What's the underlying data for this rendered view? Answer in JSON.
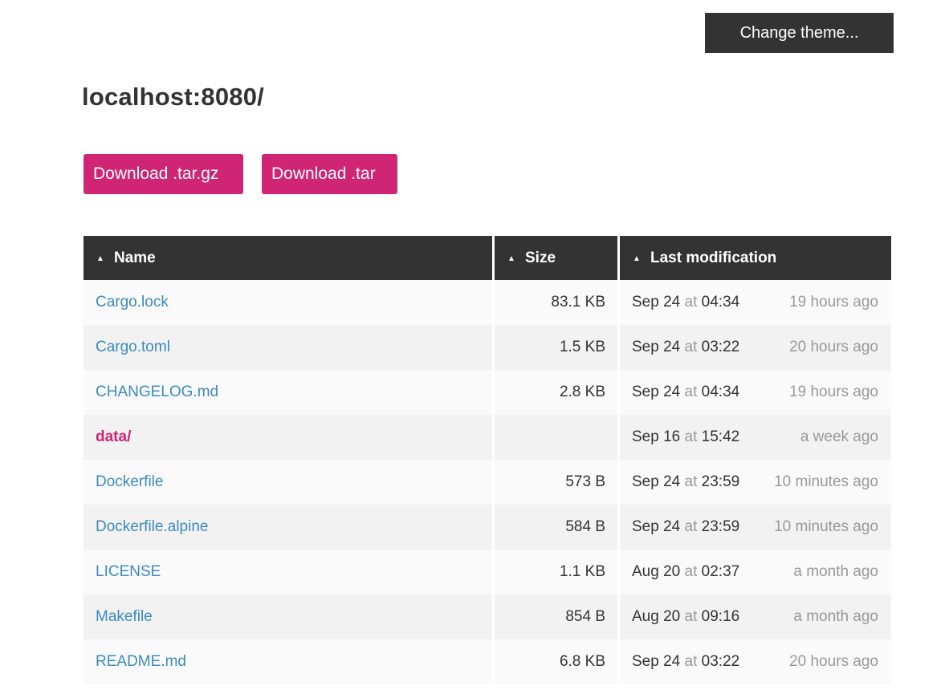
{
  "header": {
    "theme_button_label": "Change theme...",
    "title": "localhost:8080/"
  },
  "downloads": {
    "targz_label": "Download .tar.gz",
    "tar_label": "Download .tar"
  },
  "table": {
    "columns": [
      {
        "label": "Name",
        "sort_icon": "triangle-up-icon"
      },
      {
        "label": "Size",
        "sort_icon": "triangle-up-icon"
      },
      {
        "label": "Last modification",
        "sort_icon": "triangle-up-icon"
      }
    ],
    "at_word": "at",
    "rows": [
      {
        "name": "Cargo.lock",
        "is_dir": false,
        "size": "83.1 KB",
        "date": "Sep 24",
        "time": "04:34",
        "ago": "19 hours ago"
      },
      {
        "name": "Cargo.toml",
        "is_dir": false,
        "size": "1.5 KB",
        "date": "Sep 24",
        "time": "03:22",
        "ago": "20 hours ago"
      },
      {
        "name": "CHANGELOG.md",
        "is_dir": false,
        "size": "2.8 KB",
        "date": "Sep 24",
        "time": "04:34",
        "ago": "19 hours ago"
      },
      {
        "name": "data/",
        "is_dir": true,
        "size": "",
        "date": "Sep 16",
        "time": "15:42",
        "ago": "a week ago"
      },
      {
        "name": "Dockerfile",
        "is_dir": false,
        "size": "573 B",
        "date": "Sep 24",
        "time": "23:59",
        "ago": "10 minutes ago"
      },
      {
        "name": "Dockerfile.alpine",
        "is_dir": false,
        "size": "584 B",
        "date": "Sep 24",
        "time": "23:59",
        "ago": "10 minutes ago"
      },
      {
        "name": "LICENSE",
        "is_dir": false,
        "size": "1.1 KB",
        "date": "Aug 20",
        "time": "02:37",
        "ago": "a month ago"
      },
      {
        "name": "Makefile",
        "is_dir": false,
        "size": "854 B",
        "date": "Aug 20",
        "time": "09:16",
        "ago": "a month ago"
      },
      {
        "name": "README.md",
        "is_dir": false,
        "size": "6.8 KB",
        "date": "Sep 24",
        "time": "03:22",
        "ago": "20 hours ago"
      }
    ]
  },
  "colors": {
    "accent": "#d02474",
    "link": "#3a8bbf",
    "header_bg": "#333333"
  }
}
